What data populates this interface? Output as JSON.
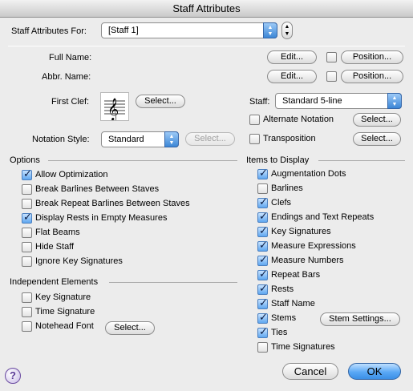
{
  "window": {
    "title": "Staff Attributes"
  },
  "header": {
    "label": "Staff Attributes For:",
    "staff_value": "[Staff 1]"
  },
  "names": {
    "full_name_label": "Full Name:",
    "abbr_name_label": "Abbr. Name:",
    "edit_label": "Edit...",
    "position_label": "Position..."
  },
  "clef": {
    "label": "First Clef:",
    "select_label": "Select...",
    "glyph": "𝄞"
  },
  "staff": {
    "label": "Staff:",
    "value": "Standard 5-line",
    "alternate_notation_label": "Alternate Notation",
    "transposition_label": "Transposition",
    "select_label": "Select..."
  },
  "notation_style": {
    "label": "Notation Style:",
    "value": "Standard",
    "select_label": "Select..."
  },
  "options": {
    "title": "Options",
    "items": [
      {
        "label": "Allow Optimization",
        "checked": true
      },
      {
        "label": "Break Barlines Between Staves",
        "checked": false
      },
      {
        "label": "Break Repeat Barlines Between Staves",
        "checked": false
      },
      {
        "label": "Display Rests in Empty Measures",
        "checked": true
      },
      {
        "label": "Flat Beams",
        "checked": false
      },
      {
        "label": "Hide Staff",
        "checked": false
      },
      {
        "label": "Ignore Key Signatures",
        "checked": false
      }
    ]
  },
  "independent": {
    "title": "Independent Elements",
    "items": [
      {
        "label": "Key Signature",
        "checked": false
      },
      {
        "label": "Time Signature",
        "checked": false
      },
      {
        "label": "Notehead Font",
        "checked": false
      }
    ],
    "select_label": "Select..."
  },
  "display": {
    "title": "Items to Display",
    "items": [
      {
        "label": "Augmentation Dots",
        "checked": true
      },
      {
        "label": "Barlines",
        "checked": false
      },
      {
        "label": "Clefs",
        "checked": true
      },
      {
        "label": "Endings and Text Repeats",
        "checked": true
      },
      {
        "label": "Key Signatures",
        "checked": true
      },
      {
        "label": "Measure Expressions",
        "checked": true
      },
      {
        "label": "Measure Numbers",
        "checked": true
      },
      {
        "label": "Repeat Bars",
        "checked": true
      },
      {
        "label": "Rests",
        "checked": true
      },
      {
        "label": "Staff Name",
        "checked": true
      },
      {
        "label": "Stems",
        "checked": true
      },
      {
        "label": "Ties",
        "checked": true
      },
      {
        "label": "Time Signatures",
        "checked": false
      }
    ],
    "stem_settings_label": "Stem Settings..."
  },
  "footer": {
    "help": "?",
    "cancel_label": "Cancel",
    "ok_label": "OK"
  }
}
